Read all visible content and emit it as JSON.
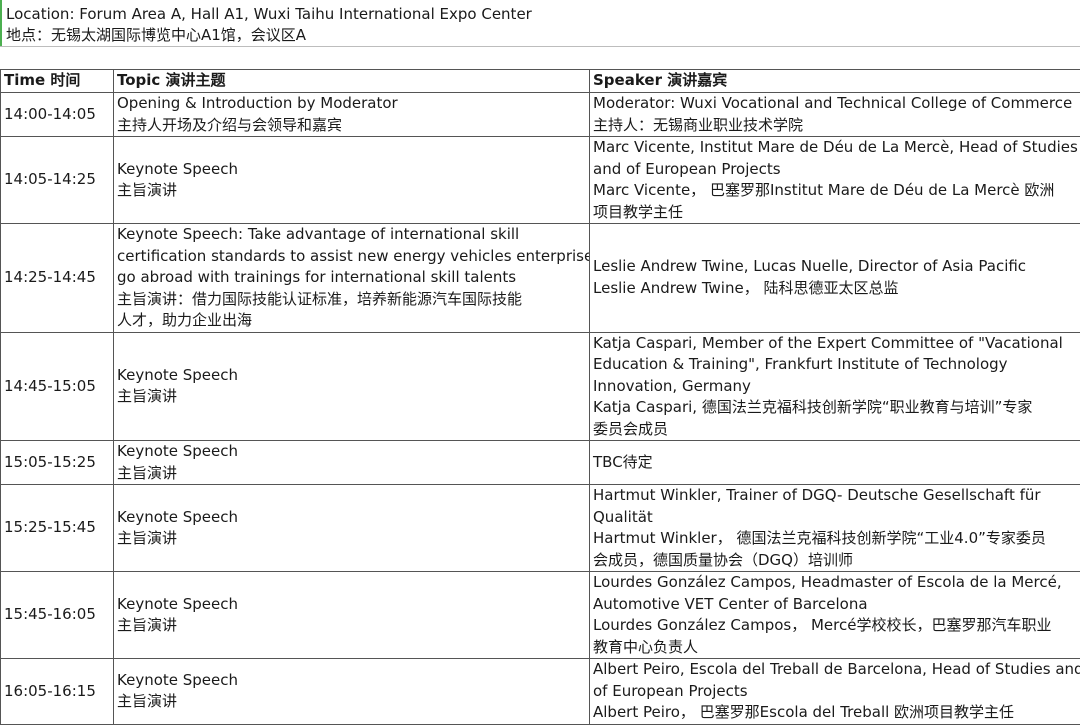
{
  "location": {
    "en": "Location: Forum Area A, Hall A1, Wuxi Taihu International Expo Center",
    "zh": "地点：无锡太湖国际博览中心A1馆，会议区A"
  },
  "table": {
    "headers": {
      "time": "Time 时间",
      "topic": "Topic 演讲主题",
      "speaker": "Speaker 演讲嘉宾"
    },
    "rows": [
      {
        "time": "14:00-14:05",
        "topic": [
          "Opening & Introduction by Moderator",
          "主持人开场及介绍与会领导和嘉宾"
        ],
        "speaker": [
          "Moderator: Wuxi Vocational and Technical College of Commerce",
          "主持人：无锡商业职业技术学院"
        ]
      },
      {
        "time": "14:05-14:25",
        "topic": [
          "Keynote Speech",
          "主旨演讲"
        ],
        "speaker": [
          "Marc Vicente, Institut Mare de Déu de La Mercè, Head of Studies",
          "and of European Projects",
          "Marc Vicente， 巴塞罗那Institut Mare de Déu de La Mercè 欧洲",
          "项目教学主任"
        ]
      },
      {
        "time": "14:25-14:45",
        "topic": [
          "Keynote Speech: Take advantage of international skill",
          "certification standards to assist new energy vehicles enterprises",
          "go abroad with trainings for international skill talents",
          "主旨演讲：借力国际技能认证标准，培养新能源汽车国际技能",
          "人才，助力企业出海"
        ],
        "speaker": [
          "Leslie Andrew Twine, Lucas Nuelle, Director of Asia Pacific",
          "Leslie Andrew Twine， 陆科思德亚太区总监"
        ]
      },
      {
        "time": "14:45-15:05",
        "topic": [
          "Keynote Speech",
          "主旨演讲"
        ],
        "speaker": [
          "Katja Caspari, Member of the Expert Committee of \"Vacational",
          "Education & Training\", Frankfurt Institute of Technology",
          "Innovation, Germany",
          "Katja Caspari, 德国法兰克福科技创新学院“职业教育与培训”专家",
          "委员会成员"
        ]
      },
      {
        "time": "15:05-15:25",
        "topic": [
          "Keynote Speech",
          "主旨演讲"
        ],
        "speaker": [
          "TBC待定"
        ]
      },
      {
        "time": "15:25-15:45",
        "topic": [
          "Keynote Speech",
          "主旨演讲"
        ],
        "speaker": [
          "Hartmut Winkler, Trainer of DGQ- Deutsche Gesellschaft für",
          "Qualität",
          "Hartmut Winkler， 德国法兰克福科技创新学院“工业4.0”专家委员",
          "会成员，德国质量协会（DGQ）培训师"
        ]
      },
      {
        "time": "15:45-16:05",
        "topic": [
          "Keynote Speech",
          "主旨演讲"
        ],
        "speaker": [
          "Lourdes González Campos, Headmaster of Escola de la Mercé,",
          "Automotive VET Center of Barcelona",
          "Lourdes González Campos， Mercé学校校长，巴塞罗那汽车职业",
          "教育中心负责人"
        ]
      },
      {
        "time": "16:05-16:15",
        "topic": [
          "Keynote Speech",
          "主旨演讲"
        ],
        "speaker": [
          "Albert Peiro, Escola del Treball de Barcelona, Head of Studies and",
          "of European Projects",
          "Albert Peiro， 巴塞罗那Escola del Treball 欧洲项目教学主任"
        ]
      }
    ]
  }
}
